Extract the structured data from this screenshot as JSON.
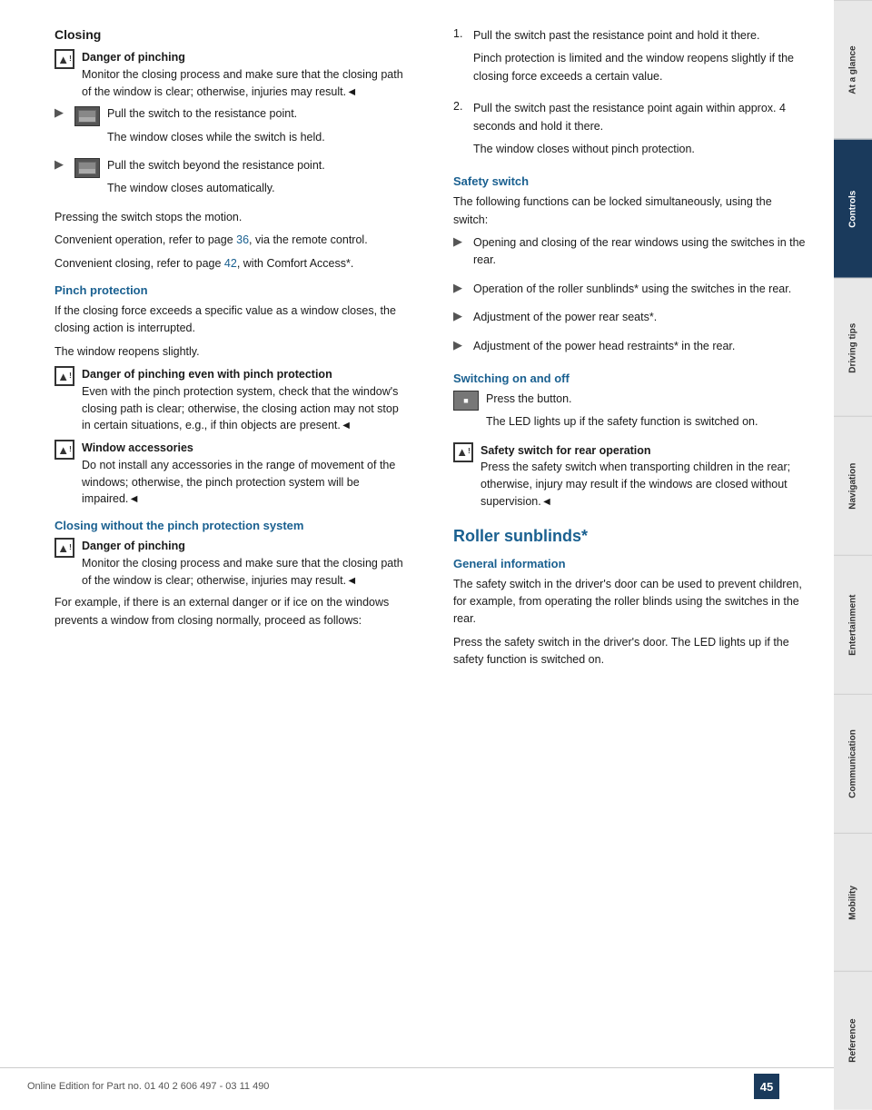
{
  "sidebar": {
    "items": [
      {
        "label": "At a glance",
        "active": false
      },
      {
        "label": "Controls",
        "active": true
      },
      {
        "label": "Driving tips",
        "active": false
      },
      {
        "label": "Navigation",
        "active": false
      },
      {
        "label": "Entertainment",
        "active": false
      },
      {
        "label": "Communication",
        "active": false
      },
      {
        "label": "Mobility",
        "active": false
      },
      {
        "label": "Reference",
        "active": false
      }
    ]
  },
  "page": {
    "number": "45",
    "footer_text": "Online Edition for Part no. 01 40 2 606 497 - 03 11 490"
  },
  "left_col": {
    "title": "Closing",
    "warning1": {
      "title": "Danger of pinching",
      "text": "Monitor the closing process and make sure that the closing path of the window is clear; otherwise, injuries may result.◄"
    },
    "action1_text": "Pull the switch to the resistance point.",
    "action1_sub": "The window closes while the switch is held.",
    "action2_text": "Pull the switch beyond the resistance point.",
    "action2_sub": "The window closes automatically.",
    "press_text": "Pressing the switch stops the motion.",
    "convenient1": "Convenient operation, refer to page",
    "convenient1_page": "36",
    "convenient1_suffix": ", via the remote control.",
    "convenient2": "Convenient closing, refer to page",
    "convenient2_page": "42",
    "convenient2_suffix": ", with Comfort Access*.",
    "pinch_title": "Pinch protection",
    "pinch_text1": "If the closing force exceeds a specific value as a window closes, the closing action is interrupted.",
    "pinch_text2": "The window reopens slightly.",
    "pinch_warning": {
      "title": "Danger of pinching even with pinch protection",
      "text": "Even with the pinch protection system, check that the window's closing path is clear; otherwise, the closing action may not stop in certain situations, e.g., if thin objects are present.◄"
    },
    "window_warning": {
      "title": "Window accessories",
      "text": "Do not install any accessories in the range of movement of the windows; otherwise, the pinch protection system will be impaired.◄"
    },
    "closing_without_title": "Closing without the pinch protection system",
    "closing_without_warning": {
      "title": "Danger of pinching",
      "text": "Monitor the closing process and make sure that the closing path of the window is clear; otherwise, injuries may result.◄"
    },
    "closing_without_text": "For example, if there is an external danger or if ice on the windows prevents a window from closing normally, proceed as follows:"
  },
  "right_col": {
    "step1_text": "Pull the switch past the resistance point and hold it there.",
    "step1_sub": "Pinch protection is limited and the window reopens slightly if the closing force exceeds a certain value.",
    "step2_text": "Pull the switch past the resistance point again within approx. 4 seconds and hold it there.",
    "step2_sub": "The window closes without pinch protection.",
    "safety_title": "Safety switch",
    "safety_text": "The following functions can be locked simultaneously, using the switch:",
    "safety_bullets": [
      "Opening and closing of the rear windows using the switches in the rear.",
      "Operation of the roller sunblinds* using the switches in the rear.",
      "Adjustment of the power rear seats*.",
      "Adjustment of the power head restraints* in the rear."
    ],
    "switching_title": "Switching on and off",
    "switching_text1": "Press the button.",
    "switching_text2": "The LED lights up if the safety function is switched on.",
    "safety_rear_warning": {
      "title": "Safety switch for rear operation",
      "text": "Press the safety switch when transporting children in the rear; otherwise, injury may result if the windows are closed without supervision.◄"
    },
    "roller_title": "Roller sunblinds*",
    "general_title": "General information",
    "general_text1": "The safety switch in the driver's door can be used to prevent children, for example, from operating the roller blinds using the switches in the rear.",
    "general_text2": "Press the safety switch in the driver's door. The LED lights up if the safety function is switched on."
  }
}
